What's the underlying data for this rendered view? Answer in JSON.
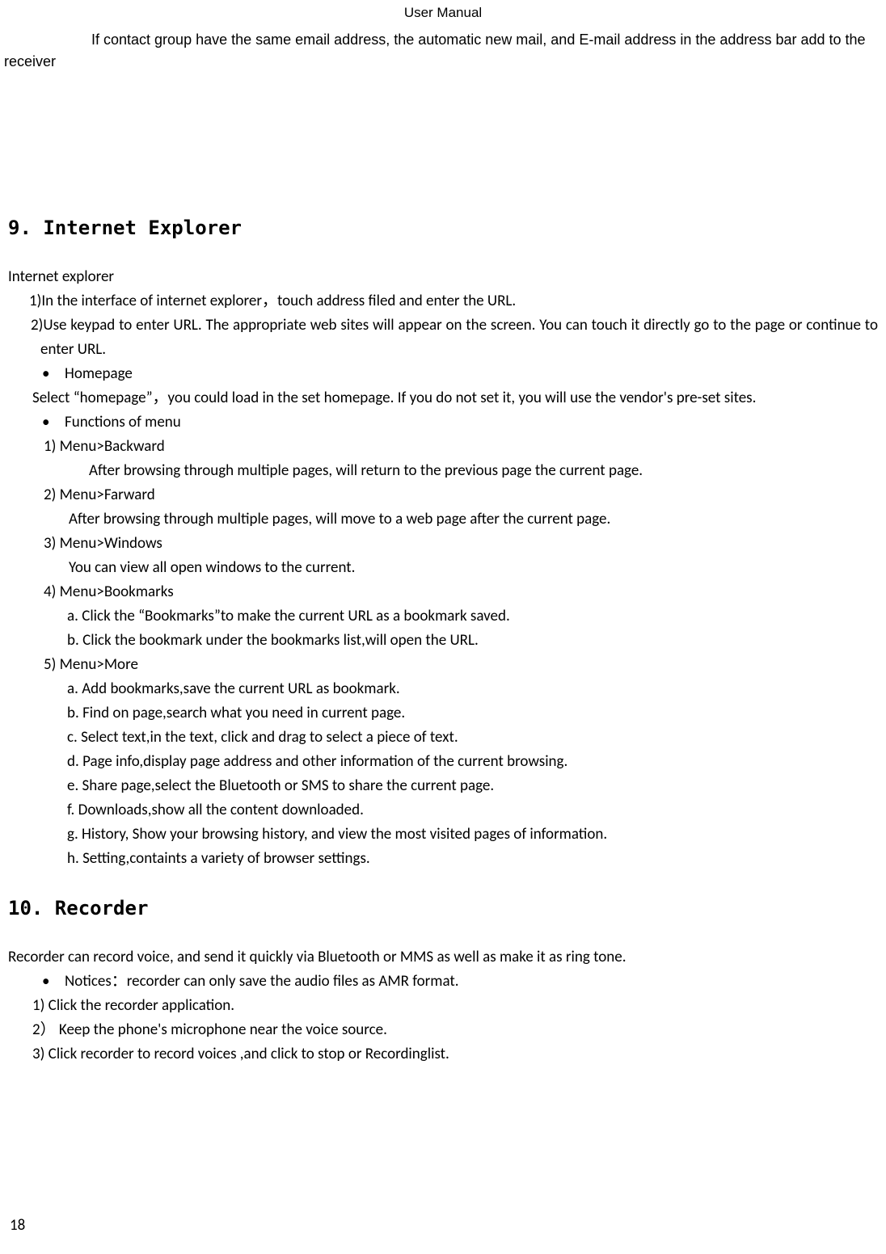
{
  "header": {
    "title": "User    Manual"
  },
  "intro": {
    "text": "If contact group have the same email address, the automatic new mail, and E-mail address in the address bar add to the receiver"
  },
  "section9": {
    "heading": "9. Internet Explorer",
    "subheading": "Internet explorer",
    "step1": "1)In the interface of internet explorer，touch address filed and enter the URL.",
    "step2": "2)Use keypad to enter URL. The appropriate web sites will appear on the screen. You can touch it directly go to the page or continue to enter URL.",
    "bullet_homepage": "Homepage",
    "homepage_text": "Select   “homepage”，you could load in the set homepage. If you do not set it, you will use the vendor's pre-set sites.",
    "bullet_functions": "Functions of menu",
    "fn1": "1)   Menu>Backward",
    "fn1_desc": "After browsing through multiple pages, will return to the previous page the current page.",
    "fn2": "2)   Menu>Farward",
    "fn2_desc": "After browsing through multiple pages, will move to a web page after the current page.",
    "fn3": "3)   Menu>Windows",
    "fn3_desc": "You can view all open windows to the current.",
    "fn4": "4)   Menu>Bookmarks",
    "fn4_a": "a.    Click the “Bookmarks”to make the current URL as a bookmark saved.",
    "fn4_b": "b.    Click the bookmark under the bookmarks list,will open the URL.",
    "fn5": "5)   Menu>More",
    "fn5_a": "a.    Add bookmarks,save the current URL as bookmark.",
    "fn5_b": "b.    Find on page,search what you need in current page.",
    "fn5_c": "c.    Select text,in the text, click and drag to select a piece of text.",
    "fn5_d": "d.    Page info,display page address and other information of the current browsing.",
    "fn5_e": "e.    Share page,select the Bluetooth or SMS to share the current page.",
    "fn5_f": "f.     Downloads,show all the content downloaded.",
    "fn5_g": "g.    History, Show your browsing history, and view the most visited pages of information.",
    "fn5_h": "h.    Setting,containts a variety of browser settings."
  },
  "section10": {
    "heading": "10. Recorder",
    "intro": "Recorder can record voice, and send it quickly via Bluetooth or MMS as well as make it as ring tone.",
    "bullet_notices": "Notices：recorder can only save the audio files as AMR format.",
    "step1": "1) Click the recorder application.",
    "step2": "2） Keep the phone's microphone near the voice source.",
    "step3": "3) Click recorder to record voices ,and click to stop or Recordinglist."
  },
  "page_number": "18"
}
